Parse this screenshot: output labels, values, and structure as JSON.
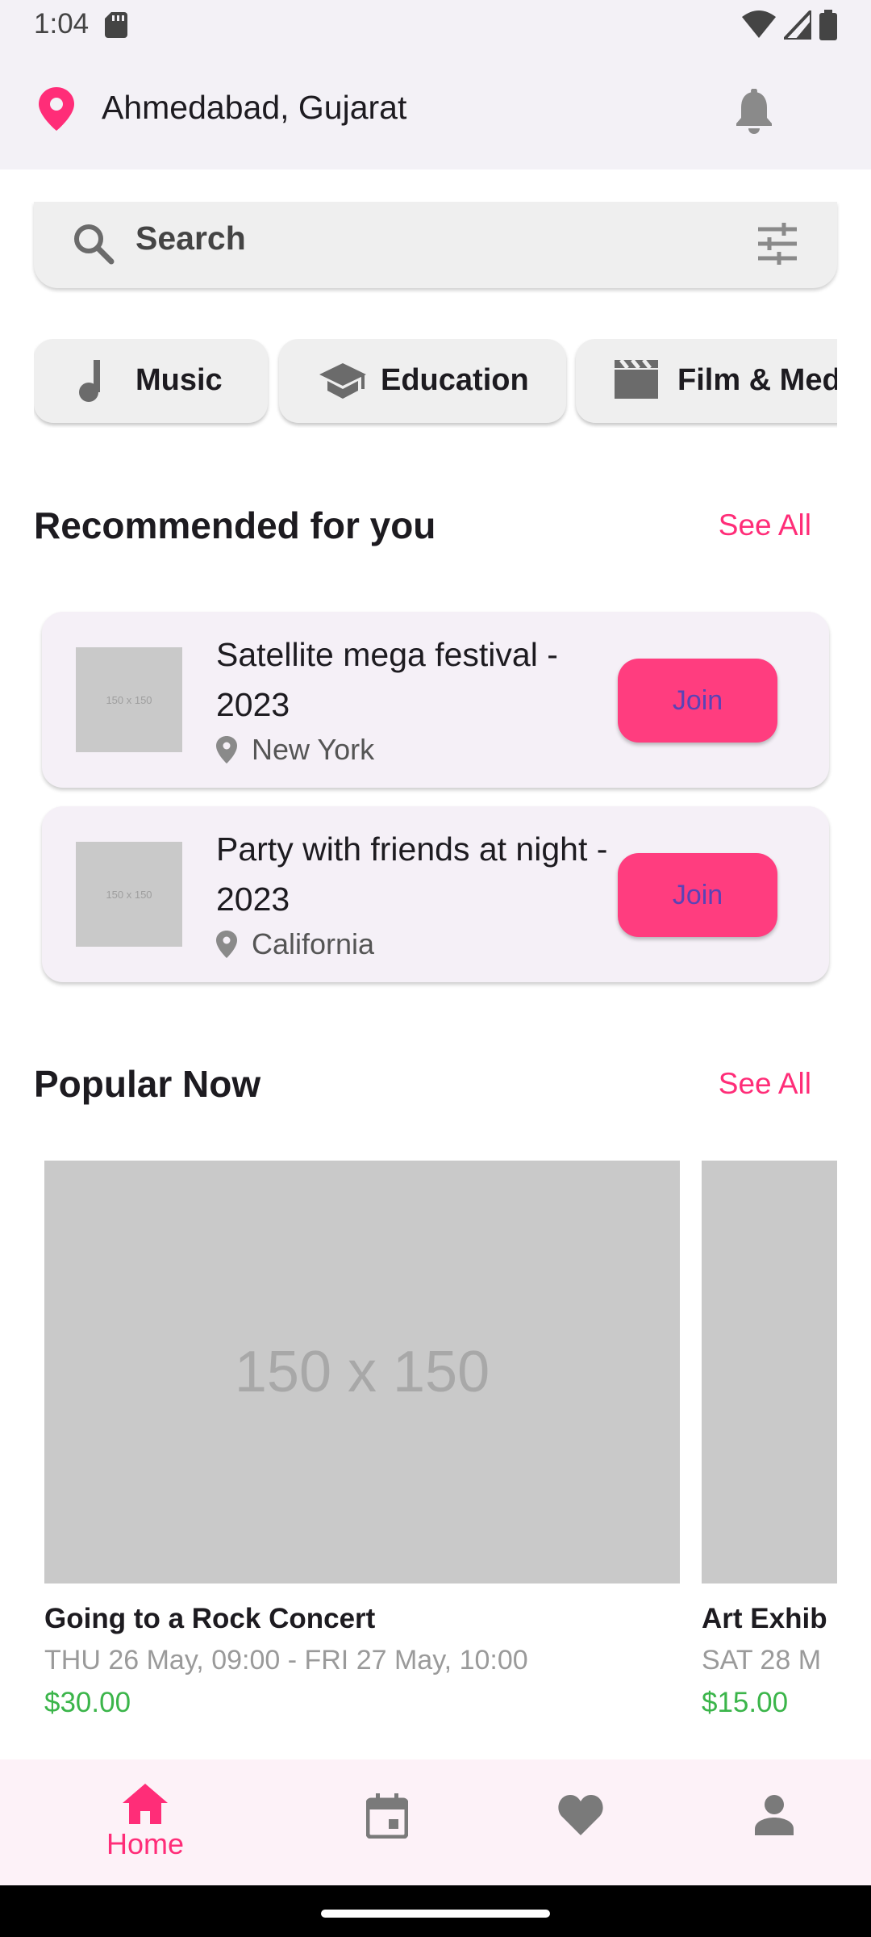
{
  "status_bar": {
    "time": "1:04",
    "icons": [
      "sd-card-icon",
      "wifi-icon",
      "cell-signal-icon",
      "battery-icon"
    ]
  },
  "app_bar": {
    "location": "Ahmedabad, Gujarat",
    "location_icon": "location-pin-icon",
    "notification_icon": "bell-icon"
  },
  "search": {
    "placeholder": "Search",
    "icon": "search-icon",
    "filter_icon": "filter-icon"
  },
  "categories": [
    {
      "label": "Music",
      "icon": "music-note-icon"
    },
    {
      "label": "Education",
      "icon": "school-icon"
    },
    {
      "label": "Film & Medi",
      "icon": "movie-icon"
    }
  ],
  "recommended": {
    "title": "Recommended for you",
    "see_all": "See All",
    "items": [
      {
        "thumb_text": "150 x 150",
        "title": "Satellite mega festival - 2023",
        "location": "New York",
        "button": "Join"
      },
      {
        "thumb_text": "150 x 150",
        "title": "Party with friends at night - 2023",
        "location": "California",
        "button": "Join"
      }
    ]
  },
  "popular": {
    "title": "Popular Now",
    "see_all": "See All",
    "items": [
      {
        "image_text": "150 x 150",
        "title": "Going to a Rock Concert",
        "date": "THU 26 May, 09:00 - FRI 27 May, 10:00",
        "price": "$30.00"
      },
      {
        "image_text": "",
        "title": "Art Exhib",
        "date": "SAT 28 M",
        "price": "$15.00"
      }
    ]
  },
  "bottom_nav": {
    "items": [
      {
        "label": "Home",
        "icon": "home-icon",
        "active": true
      },
      {
        "label": "",
        "icon": "calendar-icon",
        "active": false
      },
      {
        "label": "",
        "icon": "heart-icon",
        "active": false
      },
      {
        "label": "",
        "icon": "person-icon",
        "active": false
      }
    ]
  },
  "colors": {
    "accent": "#ff2d78",
    "join_button": "#ff3d7f",
    "join_text": "#5b43b5",
    "price": "#3bb54a",
    "top_bar": "#f3f1f6",
    "nav_background": "#fdf2f8"
  }
}
